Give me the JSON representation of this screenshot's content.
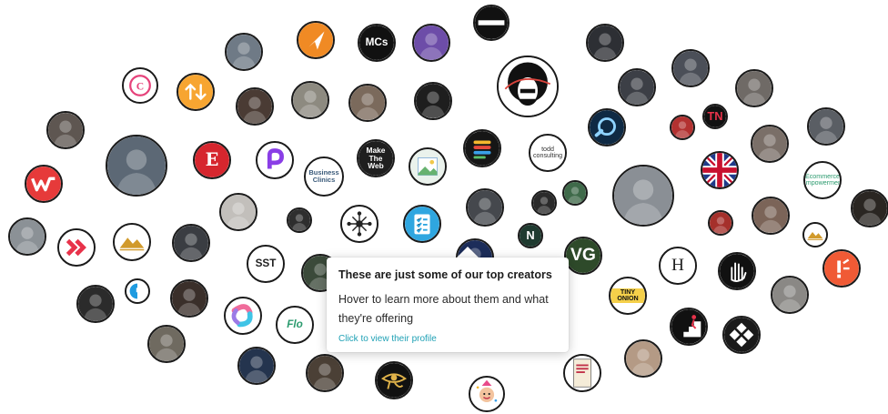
{
  "tooltip": {
    "title": "These are just some of our top creators",
    "body": "Hover to learn more about them and what they're offering",
    "link": "Click to view their profile"
  },
  "colors": {
    "bubble_border": "#1a1a1a",
    "link": "#1fa1b5",
    "tooltip_bg": "#ffffff"
  },
  "creators": [
    {
      "name": "creator-hat-beard-photo",
      "kind": "photo",
      "bg": "#6f7a86",
      "label": "",
      "icon": "avatar-photo"
    },
    {
      "name": "creator-orange-arrow",
      "kind": "logo",
      "bg": "#f08a24",
      "label": "",
      "icon": "navigation-arrow-icon"
    },
    {
      "name": "creator-mcs-logo",
      "kind": "logo",
      "bg": "#111111",
      "label": "MCs",
      "icon": ""
    },
    {
      "name": "creator-purple-art",
      "kind": "photo",
      "bg": "#6d4da8",
      "label": "",
      "icon": "avatar-photo"
    },
    {
      "name": "creator-dark-banner",
      "kind": "logo",
      "bg": "#111111",
      "label": "",
      "icon": "banner-icon"
    },
    {
      "name": "creator-afro-illustration",
      "kind": "logo",
      "bg": "#ffffff",
      "label": "",
      "icon": "afro-face-icon"
    },
    {
      "name": "creator-suit-man",
      "kind": "photo",
      "bg": "#2d2f34",
      "label": "",
      "icon": "avatar-photo"
    },
    {
      "name": "creator-pink-c",
      "kind": "logo",
      "bg": "#ffffff",
      "label": "",
      "icon": "letter-c-icon"
    },
    {
      "name": "creator-orange-updown",
      "kind": "logo",
      "bg": "#f7a531",
      "label": "",
      "icon": "up-down-arrows-icon"
    },
    {
      "name": "creator-woman-long-hair",
      "kind": "photo",
      "bg": "#4a3b34",
      "label": "",
      "icon": "avatar-photo"
    },
    {
      "name": "creator-man-field",
      "kind": "photo",
      "bg": "#8d8a80",
      "label": "",
      "icon": "avatar-photo"
    },
    {
      "name": "creator-camera-man",
      "kind": "photo",
      "bg": "#7b6a5c",
      "label": "",
      "icon": "avatar-photo"
    },
    {
      "name": "creator-dark-portrait",
      "kind": "photo",
      "bg": "#1e1e1e",
      "label": "",
      "icon": "avatar-photo"
    },
    {
      "name": "creator-dark-man-smile",
      "kind": "photo",
      "bg": "#3c3f46",
      "label": "",
      "icon": "avatar-photo"
    },
    {
      "name": "creator-man-glasses-1",
      "kind": "photo",
      "bg": "#4b4f58",
      "label": "",
      "icon": "avatar-photo"
    },
    {
      "name": "creator-man-laughing",
      "kind": "photo",
      "bg": "#6f6a66",
      "label": "",
      "icon": "avatar-photo"
    },
    {
      "name": "creator-woman-curly",
      "kind": "photo",
      "bg": "#5e5651",
      "label": "",
      "icon": "avatar-photo"
    },
    {
      "name": "creator-sunglasses-man",
      "kind": "photo",
      "bg": "#5c6875",
      "label": "",
      "icon": "avatar-photo"
    },
    {
      "name": "creator-red-e",
      "kind": "logo",
      "bg": "#d6262e",
      "label": "E",
      "icon": ""
    },
    {
      "name": "creator-purple-p",
      "kind": "logo",
      "bg": "#ffffff",
      "label": "",
      "icon": "letter-p-icon"
    },
    {
      "name": "creator-business-clinics",
      "kind": "logo",
      "bg": "#ffffff",
      "label": "Business\nClinics",
      "icon": ""
    },
    {
      "name": "creator-make-the-web",
      "kind": "logo",
      "bg": "#1f1f1f",
      "label": "Make\nThe\nWeb",
      "icon": ""
    },
    {
      "name": "creator-image-placeholder",
      "kind": "logo",
      "bg": "#eaf2ec",
      "label": "",
      "icon": "image-placeholder-icon"
    },
    {
      "name": "creator-stacked-bars",
      "kind": "logo",
      "bg": "#161616",
      "label": "",
      "icon": "stacked-bars-icon"
    },
    {
      "name": "creator-todd-consulting",
      "kind": "logo",
      "bg": "#ffffff",
      "label": "todd\nconsulting",
      "icon": ""
    },
    {
      "name": "creator-search-logo",
      "kind": "logo",
      "bg": "#0f2a44",
      "label": "",
      "icon": "search-icon"
    },
    {
      "name": "creator-red-photo",
      "kind": "photo",
      "bg": "#b33130",
      "label": "",
      "icon": "avatar-photo"
    },
    {
      "name": "creator-tn-logo",
      "kind": "logo",
      "bg": "#111111",
      "label": "TN",
      "icon": ""
    },
    {
      "name": "creator-man-beard-2",
      "kind": "photo",
      "bg": "#7a6f68",
      "label": "",
      "icon": "avatar-photo"
    },
    {
      "name": "creator-man-glasses-2",
      "kind": "photo",
      "bg": "#5a5e64",
      "label": "",
      "icon": "avatar-photo"
    },
    {
      "name": "creator-red-w",
      "kind": "logo",
      "bg": "#e63a3a",
      "label": "",
      "icon": "letter-w-icon"
    },
    {
      "name": "creator-lake-silhouette",
      "kind": "photo",
      "bg": "#8b9196",
      "label": "",
      "icon": "avatar-photo"
    },
    {
      "name": "creator-red-chevrons",
      "kind": "logo",
      "bg": "#ffffff",
      "label": "",
      "icon": "double-chevron-icon"
    },
    {
      "name": "creator-mountains",
      "kind": "logo",
      "bg": "#ffffff",
      "label": "",
      "icon": "mountains-icon"
    },
    {
      "name": "creator-man-standing",
      "kind": "photo",
      "bg": "#3a3d42",
      "label": "",
      "icon": "avatar-photo"
    },
    {
      "name": "creator-man-glasses-3",
      "kind": "photo",
      "bg": "#c2bfbb",
      "label": "",
      "icon": "avatar-photo"
    },
    {
      "name": "creator-small-portrait",
      "kind": "photo",
      "bg": "#2e2e2e",
      "label": "",
      "icon": "avatar-photo"
    },
    {
      "name": "creator-network-logo",
      "kind": "logo",
      "bg": "#ffffff",
      "label": "",
      "icon": "network-icon"
    },
    {
      "name": "creator-checklist",
      "kind": "logo",
      "bg": "#2fa6e0",
      "label": "",
      "icon": "checklist-icon"
    },
    {
      "name": "creator-man-portrait-bald",
      "kind": "photo",
      "bg": "#45484d",
      "label": "",
      "icon": "avatar-photo"
    },
    {
      "name": "creator-green-n",
      "kind": "logo",
      "bg": "#1f3b30",
      "label": "N",
      "icon": ""
    },
    {
      "name": "creator-small-man",
      "kind": "photo",
      "bg": "#2b2b2b",
      "label": "",
      "icon": "avatar-photo"
    },
    {
      "name": "creator-man-suit-green",
      "kind": "photo",
      "bg": "#3f6a4a",
      "label": "",
      "icon": "avatar-photo"
    },
    {
      "name": "creator-backpack-man",
      "kind": "photo",
      "bg": "#8a8f95",
      "label": "",
      "icon": "avatar-photo"
    },
    {
      "name": "creator-uk-flag",
      "kind": "logo",
      "bg": "#1f3a8a",
      "label": "",
      "icon": "uk-flag-icon"
    },
    {
      "name": "creator-ecommerce-empowerment",
      "kind": "logo",
      "bg": "#ffffff",
      "label": "Ecommerce\nEmpowerment",
      "icon": ""
    },
    {
      "name": "creator-red-small",
      "kind": "photo",
      "bg": "#a5302b",
      "label": "",
      "icon": "avatar-photo"
    },
    {
      "name": "creator-woman-smile",
      "kind": "photo",
      "bg": "#7b6458",
      "label": "",
      "icon": "avatar-photo"
    },
    {
      "name": "creator-small-mountain",
      "kind": "logo",
      "bg": "#ffffff",
      "label": "",
      "icon": "mountains-icon"
    },
    {
      "name": "creator-dark-man-edge",
      "kind": "photo",
      "bg": "#2a2622",
      "label": "",
      "icon": "avatar-photo"
    },
    {
      "name": "creator-sst-logo",
      "kind": "logo",
      "bg": "#ffffff",
      "label": "SST",
      "icon": ""
    },
    {
      "name": "creator-nyt-photo",
      "kind": "photo",
      "bg": "#3b4a3a",
      "label": "",
      "icon": "avatar-photo"
    },
    {
      "name": "creator-blue-small",
      "kind": "logo",
      "bg": "#1c2d5a",
      "label": "",
      "icon": "avatar-photo"
    },
    {
      "name": "creator-vg-logo",
      "kind": "logo",
      "bg": "#2e4a2a",
      "label": "VG",
      "icon": ""
    },
    {
      "name": "creator-hemingway-h",
      "kind": "logo",
      "bg": "#ffffff",
      "label": "H",
      "icon": ""
    },
    {
      "name": "creator-hand-logo",
      "kind": "logo",
      "bg": "#111111",
      "label": "",
      "icon": "hand-icon"
    },
    {
      "name": "creator-orange-exclaim",
      "kind": "logo",
      "bg": "#f05a35",
      "label": "",
      "icon": "exclaim-icon"
    },
    {
      "name": "creator-woman-dark-hair",
      "kind": "photo",
      "bg": "#2b2b2b",
      "label": "",
      "icon": "avatar-photo"
    },
    {
      "name": "creator-blue-half",
      "kind": "logo",
      "bg": "#ffffff",
      "label": "",
      "icon": "half-circle-icon"
    },
    {
      "name": "creator-desk-setup",
      "kind": "photo",
      "bg": "#3a2f2a",
      "label": "",
      "icon": "avatar-photo"
    },
    {
      "name": "creator-colorful-swirl",
      "kind": "logo",
      "bg": "#ffffff",
      "label": "",
      "icon": "swirl-icon"
    },
    {
      "name": "creator-flo",
      "kind": "logo",
      "bg": "#ffffff",
      "label": "Flo",
      "icon": ""
    },
    {
      "name": "creator-tiny-onion",
      "kind": "logo",
      "bg": "#ffffff",
      "label": "TINY ONION",
      "icon": ""
    },
    {
      "name": "creator-man-cap",
      "kind": "photo",
      "bg": "#8a8885",
      "label": "",
      "icon": "avatar-photo"
    },
    {
      "name": "creator-stairs-exit",
      "kind": "logo",
      "bg": "#111111",
      "label": "",
      "icon": "stairs-icon"
    },
    {
      "name": "creator-x-diamonds",
      "kind": "logo",
      "bg": "#1a1a1a",
      "label": "",
      "icon": "x-diamonds-icon"
    },
    {
      "name": "creator-man-glasses-4",
      "kind": "photo",
      "bg": "#6f6a60",
      "label": "",
      "icon": "avatar-photo"
    },
    {
      "name": "creator-blue-neon",
      "kind": "photo",
      "bg": "#24344e",
      "label": "",
      "icon": "avatar-photo"
    },
    {
      "name": "creator-man-denim",
      "kind": "photo",
      "bg": "#4b4036",
      "label": "",
      "icon": "avatar-photo"
    },
    {
      "name": "creator-eye-of-horus",
      "kind": "logo",
      "bg": "#111111",
      "label": "",
      "icon": "eye-icon"
    },
    {
      "name": "creator-party-cartoon",
      "kind": "logo",
      "bg": "#ffffff",
      "label": "",
      "icon": "cartoon-icon"
    },
    {
      "name": "creator-book-cover",
      "kind": "logo",
      "bg": "#ffffff",
      "label": "",
      "icon": "book-icon"
    },
    {
      "name": "creator-woman-blonde",
      "kind": "photo",
      "bg": "#b49a85",
      "label": "",
      "icon": "avatar-photo"
    },
    {
      "name": "creator-happy-face",
      "kind": "logo",
      "bg": "#ffffff",
      "label": "",
      "icon": "happy-face-icon"
    }
  ]
}
